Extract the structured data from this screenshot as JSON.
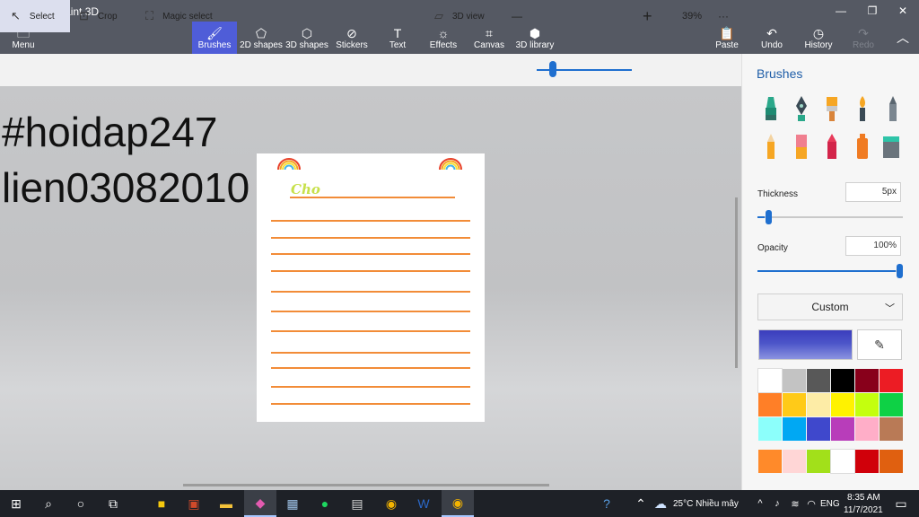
{
  "window": {
    "title": "Untitled* - Paint 3D",
    "minimize": "—",
    "maximize": "❐",
    "close": "✕"
  },
  "ribbon": {
    "menu": "Menu",
    "tabs": [
      {
        "label": "Brushes"
      },
      {
        "label": "2D shapes"
      },
      {
        "label": "3D shapes"
      },
      {
        "label": "Stickers"
      },
      {
        "label": "Text"
      },
      {
        "label": "Effects"
      },
      {
        "label": "Canvas"
      },
      {
        "label": "3D library"
      }
    ],
    "paste": "Paste",
    "undo": "Undo",
    "history": "History",
    "redo": "Redo"
  },
  "toolbar": {
    "select": "Select",
    "crop": "Crop",
    "magic_select": "Magic select",
    "view_3d": "3D view",
    "zoom_minus": "—",
    "zoom_plus": "+",
    "zoom_value": "39%",
    "zoom_level": 0.17,
    "more": "···"
  },
  "canvas": {
    "overlay_line1": "#hoidap247",
    "overlay_line2": "lien03082010",
    "heading_word": "Cho"
  },
  "panel": {
    "title": "Brushes",
    "thickness_label": "Thickness",
    "thickness_value": "5px",
    "thickness_level": 0.05,
    "opacity_label": "Opacity",
    "opacity_value": "100%",
    "opacity_level": 1.0,
    "color_mode": "Custom",
    "current_color": "#3b3dbd",
    "palette": [
      "#ffffff",
      "#c3c3c3",
      "#585858",
      "#000000",
      "#88001b",
      "#ec1c24",
      "#ff7f27",
      "#ffca18",
      "#fdeca6",
      "#fff200",
      "#c4ff0e",
      "#0ed145",
      "#8cfffb",
      "#00a8f3",
      "#3f48cc",
      "#b83dba",
      "#ffaec8",
      "#b97a56"
    ],
    "custom_row": [
      "#ff8a2a",
      "#ffd6d6",
      "#a2e01a",
      "#ffffff",
      "#d0000a",
      "#e06010"
    ]
  },
  "taskbar": {
    "weather": "25°C  Nhiều mây",
    "language": "ENG",
    "time": "8:35 AM",
    "date": "11/7/2021"
  }
}
